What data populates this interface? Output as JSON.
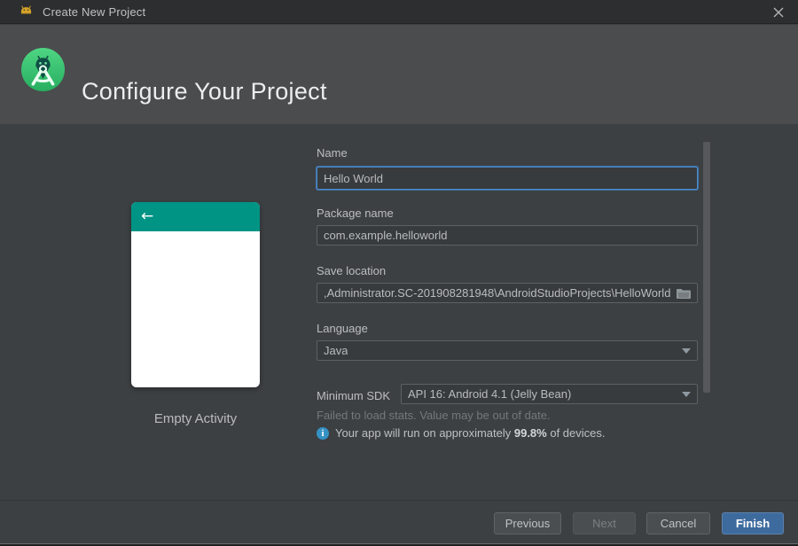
{
  "window": {
    "title": "Create New Project"
  },
  "header": {
    "title": "Configure Your Project"
  },
  "template_preview": {
    "name": "Empty Activity",
    "back_arrow": "←",
    "accent_color": "#009485"
  },
  "form": {
    "name": {
      "label": "Name",
      "value": "Hello World"
    },
    "package": {
      "label": "Package name",
      "value": "com.example.helloworld"
    },
    "save_location": {
      "label": "Save location",
      "value": ",Administrator.SC-201908281948\\AndroidStudioProjects\\HelloWorld"
    },
    "language": {
      "label": "Language",
      "value": "Java"
    },
    "min_sdk": {
      "label": "Minimum SDK",
      "value": "API 16: Android 4.1 (Jelly Bean)"
    },
    "stats_warning": "Failed to load stats. Value may be out of date.",
    "device_info": {
      "prefix": "Your app will run on approximately ",
      "highlight": "99.8%",
      "suffix": " of devices.",
      "icon_glyph": "i"
    }
  },
  "buttons": {
    "previous": "Previous",
    "next": "Next",
    "cancel": "Cancel",
    "finish": "Finish"
  },
  "colors": {
    "titlebar_bg": "#2d2e2f",
    "header_bg": "#4a4c4d",
    "content_bg": "#3d4043",
    "field_border": "#5e6162",
    "focus_blue": "#4c88c5",
    "finish_button": "#3e6b9e",
    "phone_appbar_teal": "#009485",
    "info_icon_blue": "#3592c4"
  }
}
